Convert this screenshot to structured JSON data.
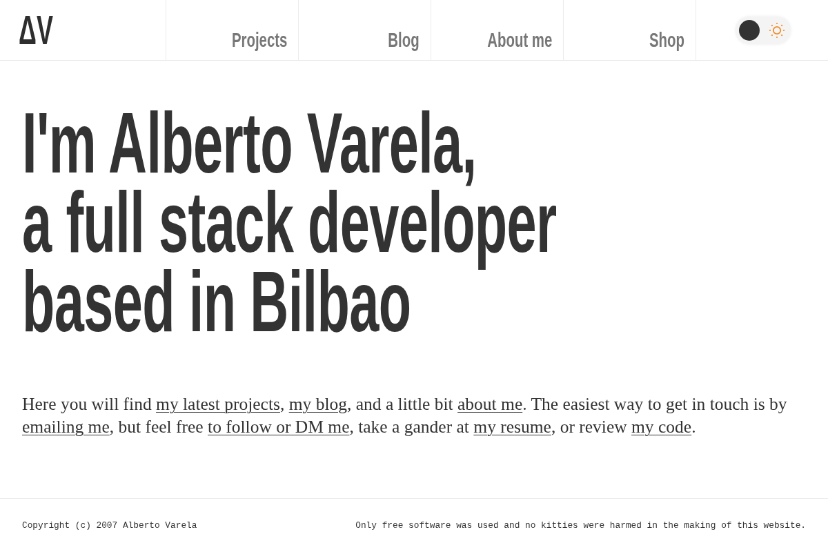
{
  "header": {
    "logo": "ΔV",
    "nav": [
      {
        "label": "Projects"
      },
      {
        "label": "Blog"
      },
      {
        "label": "About me"
      },
      {
        "label": "Shop"
      }
    ],
    "theme_toggle": {
      "dark_mode": false
    }
  },
  "hero": {
    "heading_lines": [
      "I'm Alberto Varela,",
      "a full stack developer",
      "based in Bilbao"
    ]
  },
  "intro": [
    {
      "kind": "text",
      "text": "Here you will find "
    },
    {
      "kind": "link",
      "text": "my latest projects"
    },
    {
      "kind": "text",
      "text": ", "
    },
    {
      "kind": "link",
      "text": "my blog"
    },
    {
      "kind": "text",
      "text": ", and a little bit "
    },
    {
      "kind": "link",
      "text": "about me"
    },
    {
      "kind": "text",
      "text": ". The easiest way to get in touch is by "
    },
    {
      "kind": "link",
      "text": "emailing me"
    },
    {
      "kind": "text",
      "text": ", but feel free "
    },
    {
      "kind": "link",
      "text": "to follow or DM me"
    },
    {
      "kind": "text",
      "text": ", take a gander at "
    },
    {
      "kind": "link",
      "text": "my resume"
    },
    {
      "kind": "text",
      "text": ", or review "
    },
    {
      "kind": "link",
      "text": "my code"
    },
    {
      "kind": "text",
      "text": "."
    }
  ],
  "footer": {
    "copyright": "Copyright (c) 2007 Alberto Varela",
    "note": "Only free software was used and no kitties were harmed in the making of this website."
  }
}
